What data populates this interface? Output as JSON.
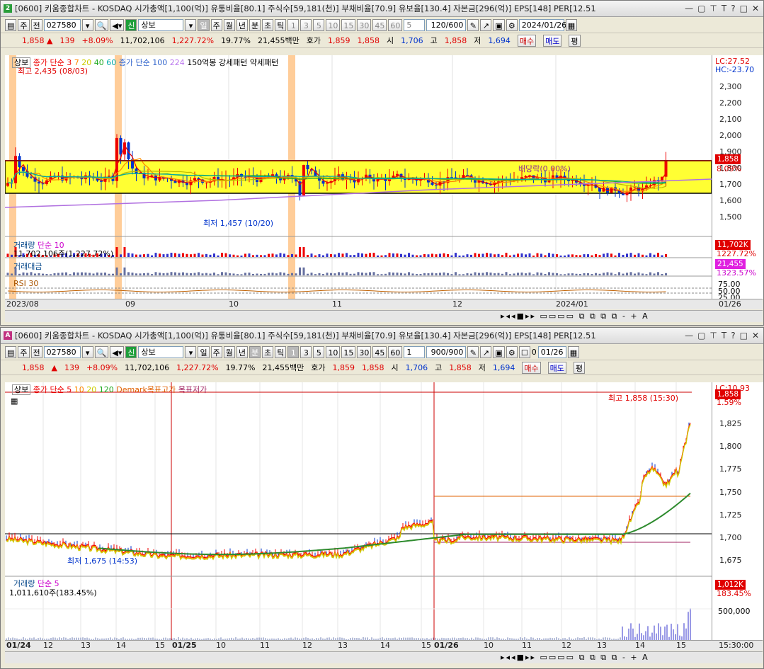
{
  "panels": [
    {
      "badge": "2",
      "badge_color": "#2a9d3a",
      "title": "[0600] 키움종합차트 - KOSDAQ 시가총액[1,100(억)] 유통비율[80.1] 주식수[59,181(천)] 부채비율[70.9] 유보율[130.4] 자본금[296(억)] EPS[148] PER[12.51",
      "toolbar": {
        "mode": "주",
        "prev": "전",
        "code": "027580",
        "stock_name": "상보",
        "periods": [
          "일",
          "주",
          "월",
          "년",
          "분",
          "초",
          "틱"
        ],
        "active_period": "일",
        "intervals": [
          "1",
          "3",
          "5",
          "10",
          "15",
          "30",
          "45",
          "60"
        ],
        "interval_value": "5",
        "count": "120/600",
        "date": "2024/01/26"
      },
      "info": {
        "price": "1,858",
        "arrow": "▲",
        "change": "139",
        "pct": "+8.09%",
        "volume": "11,702,106",
        "vol_pct": "1,227.72%",
        "turnover": "19.77%",
        "amount": "21,455백만",
        "hoga_label": "호가",
        "ask": "1,859",
        "bid": "1,858",
        "open_label": "시",
        "open": "1,706",
        "high_label": "고",
        "high": "1,858",
        "low_label": "저",
        "low": "1,694",
        "buy": "매수",
        "sell": "매도",
        "flat": "평"
      },
      "legend_main": [
        "상보",
        "종가 단순 3",
        "7",
        "20",
        "40",
        "60",
        "종가 단순 100",
        "224",
        "150억봉 강세패턴",
        "약세패턴"
      ],
      "annotations": {
        "high": "최고 2,435 (08/03)",
        "low": "최저 1,457 (10/20)",
        "dividend": "배당락(0.00%)"
      },
      "yaxis": [
        "2,300",
        "2,200",
        "2,100",
        "2,000",
        "1,900",
        "1,800",
        "1,700",
        "1,600",
        "1,500"
      ],
      "tags": {
        "lc": "LC:27.52",
        "hc": "HC:-23.70",
        "price": "1,858",
        "pct": "8.09%",
        "vol": "11,702K",
        "vol_pct": "1227.72%",
        "amt": "21,455",
        "amt_pct": "1323.57%",
        "rsi_top": "75.00",
        "rsi_mid": "50.00",
        "rsi_bot": "25.00"
      },
      "sub_legends": {
        "vol": "거래량",
        "vol_ma": "단순 10",
        "vol_text": "11,702,106주(1,227.72%)",
        "amt": "거래대금",
        "rsi": "RSI 30"
      },
      "xaxis": [
        "2023/08",
        "09",
        "10",
        "11",
        "12",
        "2024/01",
        "01/26"
      ]
    },
    {
      "badge": "A",
      "badge_color": "#c03080",
      "title": "[0600] 키움종합차트 - KOSDAQ 시가총액[1,100(억)] 유통비율[80.1] 주식수[59,181(천)] 부채비율[70.9] 유보율[130.4] 자본금[296(억)] EPS[148] PER[12.51",
      "toolbar": {
        "mode": "주",
        "prev": "전",
        "code": "027580",
        "stock_name": "상보",
        "periods": [
          "일",
          "주",
          "월",
          "년",
          "분",
          "초",
          "틱"
        ],
        "active_period": "분",
        "intervals": [
          "1",
          "3",
          "5",
          "10",
          "15",
          "30",
          "45",
          "60"
        ],
        "interval_value": "1",
        "count": "900/900",
        "checkbox": "0",
        "date": "01/26"
      },
      "info": {
        "price": "1,858",
        "arrow": "▲",
        "change": "139",
        "pct": "+8.09%",
        "volume": "11,702,106",
        "vol_pct": "1,227.72%",
        "turnover": "19.77%",
        "amount": "21,455백만",
        "hoga_label": "호가",
        "ask": "1,859",
        "bid": "1,858",
        "open_label": "시",
        "open": "1,706",
        "high_label": "고",
        "high": "1,858",
        "low_label": "저",
        "low": "1,694",
        "buy": "매수",
        "sell": "매도",
        "flat": "평"
      },
      "legend_main": [
        "상보",
        "종가 단순 5",
        "10",
        "20",
        "120",
        "Demark목표고가",
        "목표저가"
      ],
      "annotations": {
        "high": "최고 1,858 (15:30)",
        "low": "최저 1,675 (14:53)"
      },
      "yaxis": [
        "1,825",
        "1,800",
        "1,775",
        "1,750",
        "1,725",
        "1,700",
        "1,675"
      ],
      "tags": {
        "lc": "LC:10.93",
        "price": "1,858",
        "pct": "1.59%",
        "vol": "1,012K",
        "vol_pct": "183.45%",
        "vol_tick": "500,000"
      },
      "sub_legends": {
        "vol": "거래량",
        "vol_ma": "단순 5",
        "vol_text": "1,011,610주(183.45%)"
      },
      "xaxis": [
        "01/24",
        "12",
        "13",
        "14",
        "15",
        "01/25",
        "10",
        "11",
        "12",
        "13",
        "14",
        "15",
        "01/26",
        "10",
        "11",
        "12",
        "13",
        "14",
        "15",
        "15:30:00"
      ]
    }
  ],
  "colors": {
    "up": "#e00000",
    "down": "#0033cc",
    "band": "#ffff33",
    "ma_green": "#2e8b2e",
    "ma_orange": "#ff8c00",
    "ma_purple": "#b070e0"
  }
}
